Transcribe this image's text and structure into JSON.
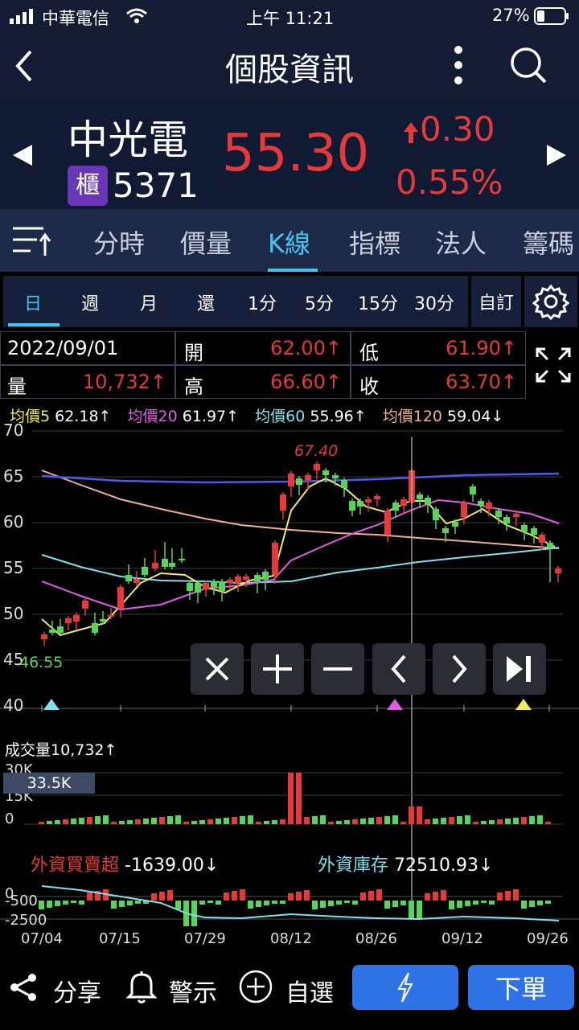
{
  "status": {
    "carrier": "中華電信",
    "time": "上午 11:21",
    "battery": "27%"
  },
  "nav": {
    "title": "個股資訊"
  },
  "stock": {
    "name": "中光電",
    "market_badge": "櫃",
    "code": "5371",
    "price": "55.30",
    "change": "0.30",
    "change_pct": "0.55%"
  },
  "tabs": [
    "分時",
    "價量",
    "K線",
    "指標",
    "法人",
    "籌碼"
  ],
  "active_tab": "K線",
  "periods": [
    "日",
    "週",
    "月",
    "還",
    "1分",
    "5分",
    "15分",
    "30分",
    "自訂"
  ],
  "active_period": "日",
  "info": {
    "date": "2022/09/01",
    "open_label": "開",
    "open": "62.00↑",
    "low_label": "低",
    "low": "61.90↑",
    "vol_label": "量",
    "vol": "10,732↑",
    "high_label": "高",
    "high": "66.60↑",
    "close_label": "收",
    "close": "63.70↑"
  },
  "ma_legend": [
    {
      "label": "均價5",
      "value": "62.18↑",
      "color": "#f3e95a"
    },
    {
      "label": "均價20",
      "value": "61.97↑",
      "color": "#e35be6"
    },
    {
      "label": "均價60",
      "value": "55.96↑",
      "color": "#7fe0f0"
    },
    {
      "label": "均價120",
      "value": "59.04↓",
      "color": "#f1b08d"
    }
  ],
  "kline": {
    "y_ticks": [
      "70",
      "65",
      "60",
      "55",
      "50",
      "45",
      "40"
    ],
    "max_label": "67.40",
    "min_label": "46.55"
  },
  "volume": {
    "title": "成交量",
    "value": "10,732↑",
    "ticks": [
      "30K",
      "15K",
      "0"
    ],
    "cursor_label": "33.5K"
  },
  "foreign": {
    "net_label": "外資買賣超",
    "net_value": "-1639.00↓",
    "hold_label": "外資庫存",
    "hold_value": "72510.93↓",
    "ticks": [
      "0",
      "-500",
      "-2500"
    ]
  },
  "x_labels": [
    "07/04",
    "07/15",
    "07/29",
    "08/12",
    "08/26",
    "09/12",
    "09/26"
  ],
  "bottom": {
    "share": "分享",
    "alert": "警示",
    "watch": "自選",
    "order": "下單"
  },
  "chart_data": {
    "type": "candlestick",
    "title": "",
    "ylim": [
      40,
      70
    ],
    "x": [
      "07/04",
      "07/15",
      "07/29",
      "08/12",
      "08/26",
      "09/12",
      "09/26"
    ],
    "candles_sample": [
      {
        "date": "2022/09/01",
        "open": 62.0,
        "high": 66.6,
        "low": 61.9,
        "close": 63.7,
        "volume": 10732
      }
    ],
    "ma": [
      {
        "name": "均價5",
        "value": 62.18
      },
      {
        "name": "均價20",
        "value": 61.97
      },
      {
        "name": "均價60",
        "value": 55.96
      },
      {
        "name": "均價120",
        "value": 59.04
      }
    ],
    "max": 67.4,
    "min": 46.55
  }
}
